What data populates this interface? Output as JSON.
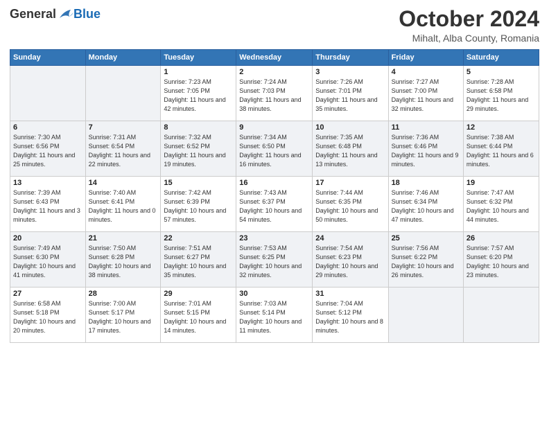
{
  "header": {
    "logo_general": "General",
    "logo_blue": "Blue",
    "month_title": "October 2024",
    "location": "Mihalt, Alba County, Romania"
  },
  "columns": [
    "Sunday",
    "Monday",
    "Tuesday",
    "Wednesday",
    "Thursday",
    "Friday",
    "Saturday"
  ],
  "weeks": [
    [
      {
        "day": "",
        "info": ""
      },
      {
        "day": "",
        "info": ""
      },
      {
        "day": "1",
        "info": "Sunrise: 7:23 AM\nSunset: 7:05 PM\nDaylight: 11 hours and 42 minutes."
      },
      {
        "day": "2",
        "info": "Sunrise: 7:24 AM\nSunset: 7:03 PM\nDaylight: 11 hours and 38 minutes."
      },
      {
        "day": "3",
        "info": "Sunrise: 7:26 AM\nSunset: 7:01 PM\nDaylight: 11 hours and 35 minutes."
      },
      {
        "day": "4",
        "info": "Sunrise: 7:27 AM\nSunset: 7:00 PM\nDaylight: 11 hours and 32 minutes."
      },
      {
        "day": "5",
        "info": "Sunrise: 7:28 AM\nSunset: 6:58 PM\nDaylight: 11 hours and 29 minutes."
      }
    ],
    [
      {
        "day": "6",
        "info": "Sunrise: 7:30 AM\nSunset: 6:56 PM\nDaylight: 11 hours and 25 minutes."
      },
      {
        "day": "7",
        "info": "Sunrise: 7:31 AM\nSunset: 6:54 PM\nDaylight: 11 hours and 22 minutes."
      },
      {
        "day": "8",
        "info": "Sunrise: 7:32 AM\nSunset: 6:52 PM\nDaylight: 11 hours and 19 minutes."
      },
      {
        "day": "9",
        "info": "Sunrise: 7:34 AM\nSunset: 6:50 PM\nDaylight: 11 hours and 16 minutes."
      },
      {
        "day": "10",
        "info": "Sunrise: 7:35 AM\nSunset: 6:48 PM\nDaylight: 11 hours and 13 minutes."
      },
      {
        "day": "11",
        "info": "Sunrise: 7:36 AM\nSunset: 6:46 PM\nDaylight: 11 hours and 9 minutes."
      },
      {
        "day": "12",
        "info": "Sunrise: 7:38 AM\nSunset: 6:44 PM\nDaylight: 11 hours and 6 minutes."
      }
    ],
    [
      {
        "day": "13",
        "info": "Sunrise: 7:39 AM\nSunset: 6:43 PM\nDaylight: 11 hours and 3 minutes."
      },
      {
        "day": "14",
        "info": "Sunrise: 7:40 AM\nSunset: 6:41 PM\nDaylight: 11 hours and 0 minutes."
      },
      {
        "day": "15",
        "info": "Sunrise: 7:42 AM\nSunset: 6:39 PM\nDaylight: 10 hours and 57 minutes."
      },
      {
        "day": "16",
        "info": "Sunrise: 7:43 AM\nSunset: 6:37 PM\nDaylight: 10 hours and 54 minutes."
      },
      {
        "day": "17",
        "info": "Sunrise: 7:44 AM\nSunset: 6:35 PM\nDaylight: 10 hours and 50 minutes."
      },
      {
        "day": "18",
        "info": "Sunrise: 7:46 AM\nSunset: 6:34 PM\nDaylight: 10 hours and 47 minutes."
      },
      {
        "day": "19",
        "info": "Sunrise: 7:47 AM\nSunset: 6:32 PM\nDaylight: 10 hours and 44 minutes."
      }
    ],
    [
      {
        "day": "20",
        "info": "Sunrise: 7:49 AM\nSunset: 6:30 PM\nDaylight: 10 hours and 41 minutes."
      },
      {
        "day": "21",
        "info": "Sunrise: 7:50 AM\nSunset: 6:28 PM\nDaylight: 10 hours and 38 minutes."
      },
      {
        "day": "22",
        "info": "Sunrise: 7:51 AM\nSunset: 6:27 PM\nDaylight: 10 hours and 35 minutes."
      },
      {
        "day": "23",
        "info": "Sunrise: 7:53 AM\nSunset: 6:25 PM\nDaylight: 10 hours and 32 minutes."
      },
      {
        "day": "24",
        "info": "Sunrise: 7:54 AM\nSunset: 6:23 PM\nDaylight: 10 hours and 29 minutes."
      },
      {
        "day": "25",
        "info": "Sunrise: 7:56 AM\nSunset: 6:22 PM\nDaylight: 10 hours and 26 minutes."
      },
      {
        "day": "26",
        "info": "Sunrise: 7:57 AM\nSunset: 6:20 PM\nDaylight: 10 hours and 23 minutes."
      }
    ],
    [
      {
        "day": "27",
        "info": "Sunrise: 6:58 AM\nSunset: 5:18 PM\nDaylight: 10 hours and 20 minutes."
      },
      {
        "day": "28",
        "info": "Sunrise: 7:00 AM\nSunset: 5:17 PM\nDaylight: 10 hours and 17 minutes."
      },
      {
        "day": "29",
        "info": "Sunrise: 7:01 AM\nSunset: 5:15 PM\nDaylight: 10 hours and 14 minutes."
      },
      {
        "day": "30",
        "info": "Sunrise: 7:03 AM\nSunset: 5:14 PM\nDaylight: 10 hours and 11 minutes."
      },
      {
        "day": "31",
        "info": "Sunrise: 7:04 AM\nSunset: 5:12 PM\nDaylight: 10 hours and 8 minutes."
      },
      {
        "day": "",
        "info": ""
      },
      {
        "day": "",
        "info": ""
      }
    ]
  ]
}
